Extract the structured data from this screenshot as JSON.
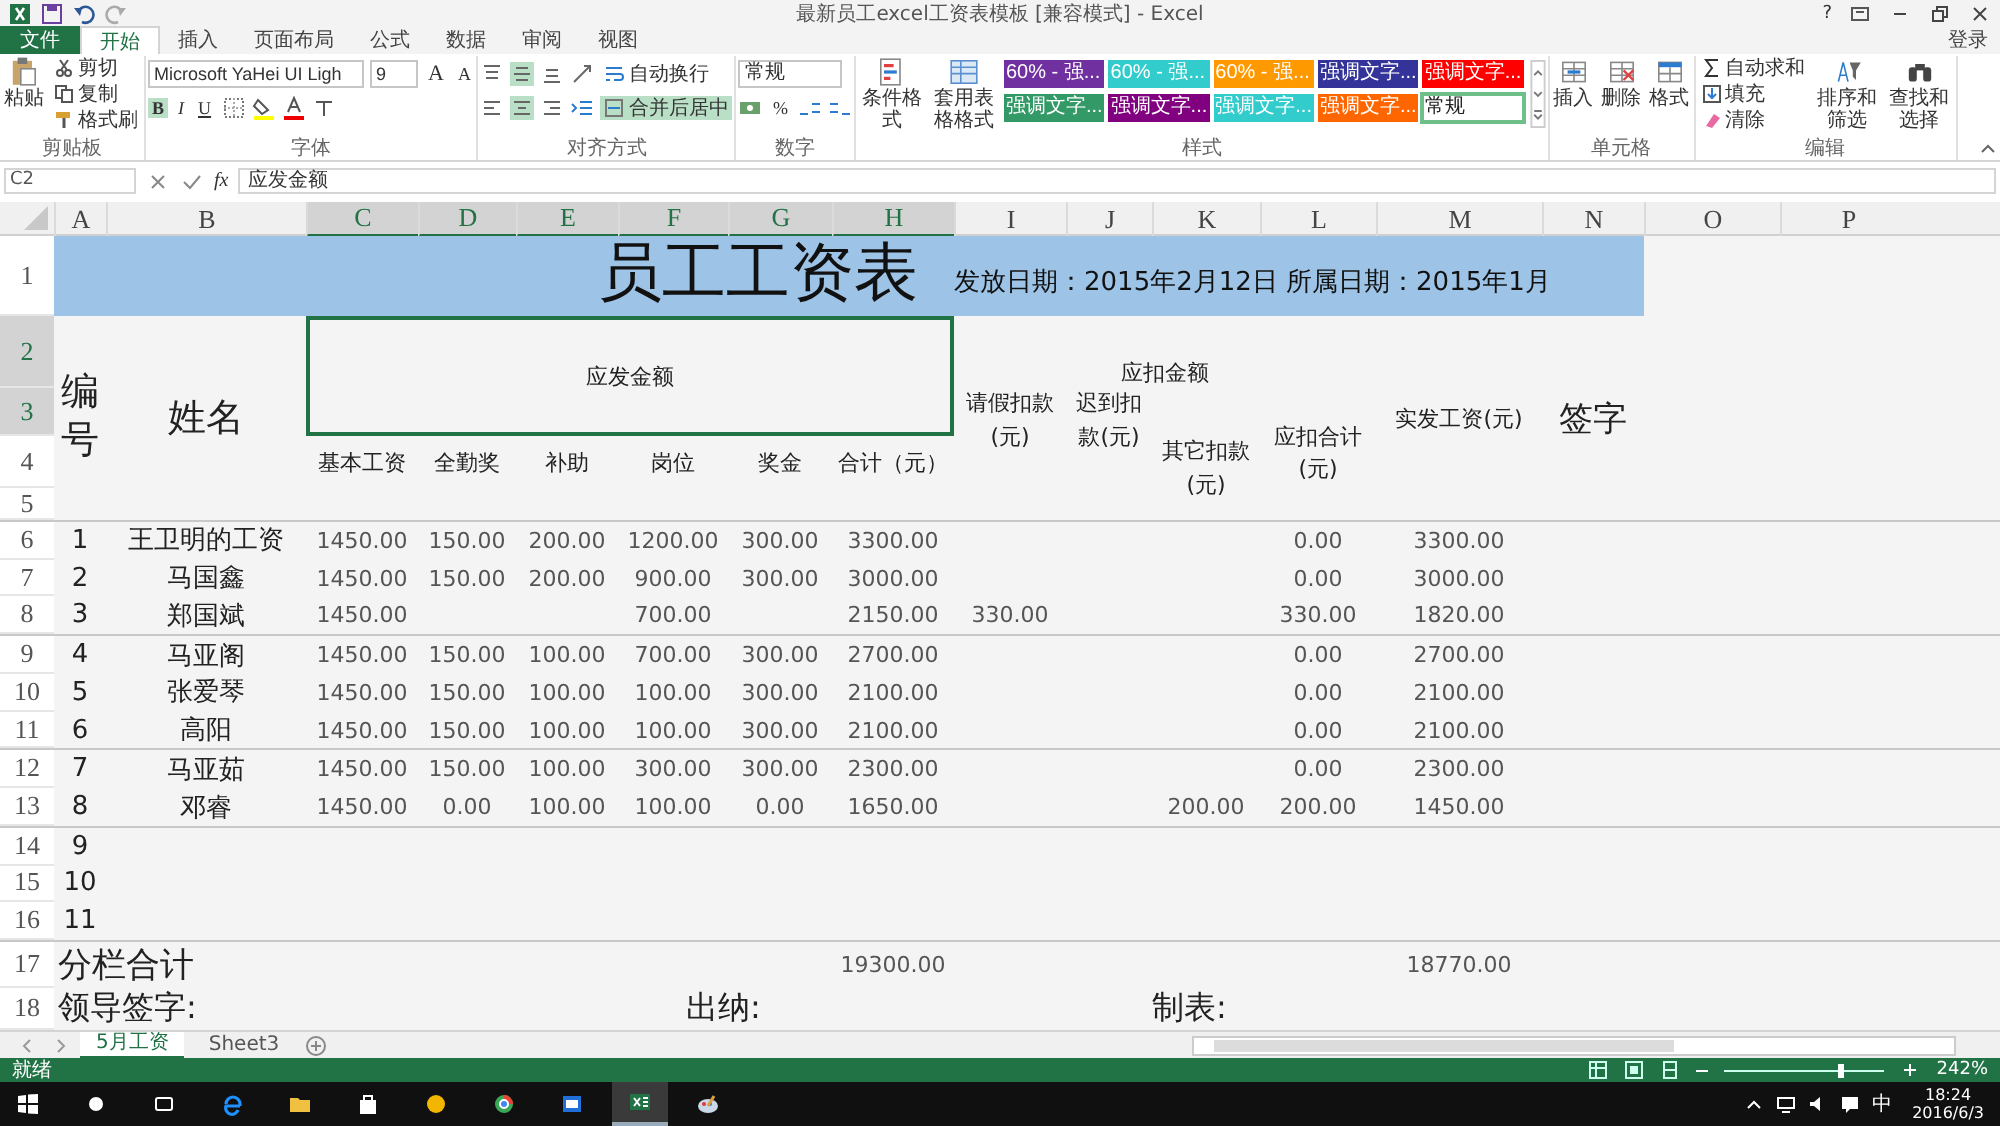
{
  "window": {
    "title": "最新员工excel工资表模板 [兼容模式] - Excel",
    "help": "?",
    "sign_in": "登录"
  },
  "tabs": [
    {
      "label": "文件",
      "kind": "file",
      "selected": false
    },
    {
      "label": "开始",
      "kind": "tab",
      "selected": true
    },
    {
      "label": "插入",
      "kind": "tab",
      "selected": false
    },
    {
      "label": "页面布局",
      "kind": "tab",
      "selected": false
    },
    {
      "label": "公式",
      "kind": "tab",
      "selected": false
    },
    {
      "label": "数据",
      "kind": "tab",
      "selected": false
    },
    {
      "label": "审阅",
      "kind": "tab",
      "selected": false
    },
    {
      "label": "视图",
      "kind": "tab",
      "selected": false
    }
  ],
  "ribbon": {
    "clipboard": {
      "label": "剪贴板",
      "paste": "粘贴",
      "cut": "剪切",
      "copy": "复制",
      "format_painter": "格式刷"
    },
    "font": {
      "label": "字体",
      "font_name": "Microsoft YaHei UI Ligh",
      "font_size": "9",
      "grow": "A",
      "shrink": "A",
      "bold": "B",
      "italic": "I",
      "underline": "U"
    },
    "alignment": {
      "label": "对齐方式",
      "wrap_text": {
        "label": "自动换行",
        "on": false
      },
      "merge_center": {
        "label": "合并后居中",
        "on": true
      }
    },
    "number": {
      "label": "数字",
      "format": "常规",
      "percent": "%"
    },
    "styles": {
      "label": "样式",
      "conditional": "条件格式",
      "table_format": "套用表格格式",
      "swatches": [
        {
          "label": "60% - 强...",
          "color": "#7030a0",
          "selected": false
        },
        {
          "label": "60% - 强...",
          "color": "#33cccc",
          "selected": false
        },
        {
          "label": "60% - 强...",
          "color": "#ff9900",
          "selected": false
        },
        {
          "label": "强调文字...",
          "color": "#333399",
          "selected": false
        },
        {
          "label": "强调文字...",
          "color": "#ff0000",
          "selected": false
        },
        {
          "label": "强调文字...",
          "color": "#339966",
          "selected": false
        },
        {
          "label": "强调文字...",
          "color": "#800080",
          "selected": false
        },
        {
          "label": "强调文字...",
          "color": "#33cccc",
          "selected": false
        },
        {
          "label": "强调文字...",
          "color": "#ff6600",
          "selected": false
        },
        {
          "label": "常规",
          "color": "#ffffff",
          "selected": true
        }
      ]
    },
    "cells": {
      "label": "单元格",
      "insert": "插入",
      "delete": "删除",
      "format": "格式"
    },
    "editing": {
      "label": "编辑",
      "autosum": "自动求和",
      "fill": "填充",
      "clear": "清除",
      "sort_filter": "排序和筛选",
      "find_select": "查找和选择"
    }
  },
  "formula_bar": {
    "name_box": "C2",
    "function_label": "fx",
    "formula": "应发金额"
  },
  "columns": [
    {
      "label": "A",
      "selected": false
    },
    {
      "label": "B",
      "selected": false
    },
    {
      "label": "C",
      "selected": true
    },
    {
      "label": "D",
      "selected": true
    },
    {
      "label": "E",
      "selected": true
    },
    {
      "label": "F",
      "selected": true
    },
    {
      "label": "G",
      "selected": true
    },
    {
      "label": "H",
      "selected": true
    },
    {
      "label": "I",
      "selected": false
    },
    {
      "label": "J",
      "selected": false
    },
    {
      "label": "K",
      "selected": false
    },
    {
      "label": "L",
      "selected": false
    },
    {
      "label": "M",
      "selected": false
    },
    {
      "label": "N",
      "selected": false
    },
    {
      "label": "O",
      "selected": false
    },
    {
      "label": "P",
      "selected": false
    }
  ],
  "rows": [
    {
      "label": "1",
      "selected": false
    },
    {
      "label": "2",
      "selected": true
    },
    {
      "label": "3",
      "selected": true
    },
    {
      "label": "4",
      "selected": false
    },
    {
      "label": "5",
      "selected": false
    },
    {
      "label": "6",
      "selected": false
    },
    {
      "label": "7",
      "selected": false
    },
    {
      "label": "8",
      "selected": false
    },
    {
      "label": "9",
      "selected": false
    },
    {
      "label": "10",
      "selected": false
    },
    {
      "label": "11",
      "selected": false
    },
    {
      "label": "12",
      "selected": false
    },
    {
      "label": "13",
      "selected": false
    },
    {
      "label": "14",
      "selected": false
    },
    {
      "label": "15",
      "selected": false
    },
    {
      "label": "16",
      "selected": false
    },
    {
      "label": "17",
      "selected": false
    },
    {
      "label": "18",
      "selected": false
    }
  ],
  "sheet": {
    "title": "员工工资表",
    "dates": "发放日期：2015年2月12日 所属日期：2015年1月",
    "headers": {
      "number": "编号",
      "name": "姓名",
      "payable": "应发金额",
      "payable_items": [
        "基本工资",
        "全勤奖",
        "补助",
        "岗位",
        "奖金",
        "合计（元）"
      ],
      "deductions": "应扣金额",
      "leave": "请假扣款(元)",
      "late": "迟到扣款(元)",
      "other": "其它扣款(元)",
      "deduct_total": "应扣合计(元)",
      "net_pay": "实发工资(元)",
      "signature": "签字"
    },
    "groups": [
      [
        {
          "no": "1",
          "name": "王卫明的工资",
          "pay": {
            "base": "1450.00",
            "attendance": "150.00",
            "allowance": "200.00",
            "post": "1200.00",
            "bonus": "300.00",
            "total": "3300.00"
          },
          "deduct_total": "0.00",
          "net_pay": "3300.00"
        },
        {
          "no": "2",
          "name": "马国鑫",
          "pay": {
            "base": "1450.00",
            "attendance": "150.00",
            "allowance": "200.00",
            "post": "900.00",
            "bonus": "300.00",
            "total": "3000.00"
          },
          "deduct_total": "0.00",
          "net_pay": "3000.00"
        },
        {
          "no": "3",
          "name": "郑国斌",
          "pay": {
            "base": "1450.00",
            "post": "700.00",
            "total": "2150.00"
          },
          "leave": "330.00",
          "deduct_total": "330.00",
          "net_pay": "1820.00"
        }
      ],
      [
        {
          "no": "4",
          "name": "马亚阁",
          "pay": {
            "base": "1450.00",
            "attendance": "150.00",
            "allowance": "100.00",
            "post": "700.00",
            "bonus": "300.00",
            "total": "2700.00"
          },
          "deduct_total": "0.00",
          "net_pay": "2700.00"
        },
        {
          "no": "5",
          "name": "张爱琴",
          "pay": {
            "base": "1450.00",
            "attendance": "150.00",
            "allowance": "100.00",
            "post": "100.00",
            "bonus": "300.00",
            "total": "2100.00"
          },
          "deduct_total": "0.00",
          "net_pay": "2100.00"
        },
        {
          "no": "6",
          "name": "高阳",
          "pay": {
            "base": "1450.00",
            "attendance": "150.00",
            "allowance": "100.00",
            "post": "100.00",
            "bonus": "300.00",
            "total": "2100.00"
          },
          "deduct_total": "0.00",
          "net_pay": "2100.00"
        }
      ],
      [
        {
          "no": "7",
          "name": "马亚茹",
          "pay": {
            "base": "1450.00",
            "attendance": "150.00",
            "allowance": "100.00",
            "post": "300.00",
            "bonus": "300.00",
            "total": "2300.00"
          },
          "deduct_total": "0.00",
          "net_pay": "2300.00"
        },
        {
          "no": "8",
          "name": "邓睿",
          "pay": {
            "base": "1450.00",
            "attendance": "0.00",
            "allowance": "100.00",
            "post": "100.00",
            "bonus": "0.00",
            "total": "1650.00"
          },
          "other": "200.00",
          "deduct_total": "200.00",
          "net_pay": "1450.00"
        }
      ],
      [
        {
          "no": "9"
        },
        {
          "no": "10"
        },
        {
          "no": "11"
        }
      ]
    ],
    "subtotal": {
      "label": "分栏合计",
      "payable_total": "19300.00",
      "net_total": "18770.00"
    },
    "signatures": [
      "领导签字:",
      "出纳:",
      "制表:"
    ]
  },
  "sheet_tabs": [
    {
      "label": "5月工资",
      "selected": true
    },
    {
      "label": "Sheet3",
      "selected": false
    }
  ],
  "status_bar": {
    "status": "就绪",
    "zoom": {
      "level": 0.72,
      "reading": "242%"
    }
  },
  "taskbar": {
    "apps": [
      {
        "kind": "start",
        "selected": false
      },
      {
        "kind": "search",
        "selected": false
      },
      {
        "kind": "taskview",
        "selected": false
      },
      {
        "kind": "browser",
        "selected": false
      },
      {
        "kind": "folder",
        "selected": false
      },
      {
        "kind": "store",
        "selected": false
      },
      {
        "kind": "coin",
        "selected": false
      },
      {
        "kind": "chrome",
        "selected": false
      },
      {
        "kind": "window",
        "selected": false
      },
      {
        "kind": "spreadsheet",
        "selected": true
      },
      {
        "kind": "paint",
        "selected": false
      }
    ],
    "ime": "中",
    "time": "18:24",
    "date": "2016/6/3"
  }
}
